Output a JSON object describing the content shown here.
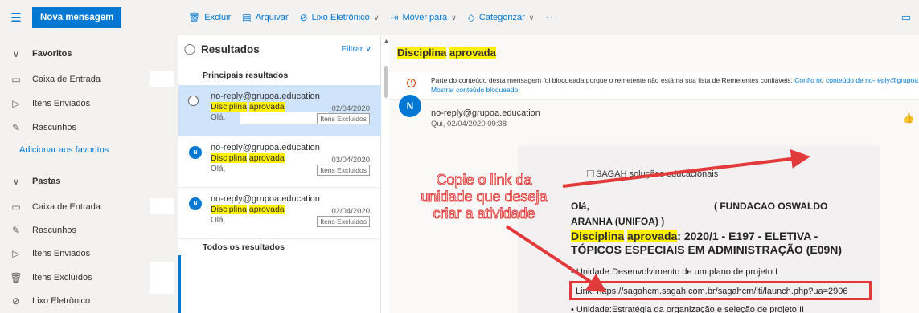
{
  "toolbar": {
    "new_message": "Nova mensagem",
    "delete": "Excluir",
    "archive": "Arquivar",
    "junk": "Lixo Eletrônico",
    "move": "Mover para",
    "categorize": "Categorizar",
    "more": "···"
  },
  "sidebar": {
    "favorites_header": "Favoritos",
    "favorites": [
      {
        "label": "Caixa de Entrada"
      },
      {
        "label": "Itens Enviados"
      },
      {
        "label": "Rascunhos"
      }
    ],
    "add_favorite": "Adicionar aos favoritos",
    "folders_header": "Pastas",
    "folders": [
      {
        "label": "Caixa de Entrada"
      },
      {
        "label": "Rascunhos"
      },
      {
        "label": "Itens Enviados"
      },
      {
        "label": "Itens Excluídos"
      },
      {
        "label": "Lixo Eletrônico"
      }
    ]
  },
  "list": {
    "title": "Resultados",
    "filter": "Filtrar",
    "top_results": "Principais resultados",
    "all_results": "Todos os resultados",
    "messages": [
      {
        "avatar": "",
        "from": "no-reply@grupoa.education",
        "subj_a": "Disciplina",
        "subj_b": "aprovada",
        "date": "02/04/2020",
        "preview": "Olá,",
        "tag": "Itens Excluídos"
      },
      {
        "avatar": "N",
        "from": "no-reply@grupoa.education",
        "subj_a": "Disciplina",
        "subj_b": "aprovada",
        "date": "03/04/2020",
        "preview": "Olá,",
        "tag": "Itens Excluídos"
      },
      {
        "avatar": "N",
        "from": "no-reply@grupoa.education",
        "subj_a": "Disciplina",
        "subj_b": "aprovada",
        "date": "02/04/2020",
        "preview": "Olá,",
        "tag": "Itens Excluídos"
      }
    ]
  },
  "reading": {
    "title_a": "Disciplina",
    "title_b": "aprovada",
    "notice": "Parte do conteúdo desta mensagem foi bloqueada porque o remetente não está na sua lista de Remetentes confiáveis.",
    "notice_link": "Confio no conteúdo de no-reply@grupoa.education",
    "show_blocked": "Mostrar conteúdo bloqueado",
    "avatar": "N",
    "sender": "no-reply@grupoa.education",
    "date": "Qui, 02/04/2020 09:38",
    "body": {
      "logo_alt": "SAGAH soluções educacionais",
      "hello": "Olá,",
      "institution": "( FUNDACAO OSWALDO",
      "institution2": "ARANHA (UNIFOA) )",
      "disc_a": "Disciplina",
      "disc_b": "aprovada",
      "disc_rest": ": 2020/1 - E197 - ELETIVA -",
      "disc_line2": "TÓPICOS ESPECIAIS EM ADMINISTRAÇÃO (E09N)",
      "unit1": "Unidade:Desenvolvimento de um plano de projeto I",
      "link": "Link: https://sagahcm.sagah.com.br/sagahcm/lti/launch.php?ua=2906",
      "unit2": "Unidade:Estratégia da organização e seleção de projeto II"
    }
  },
  "callout": {
    "line1": "Copie o link da",
    "line2": "unidade que deseja",
    "line3": "criar a atividade"
  },
  "colors": {
    "accent": "#0078d4",
    "highlight": "#fff100",
    "annotation": "#e23a3a"
  }
}
